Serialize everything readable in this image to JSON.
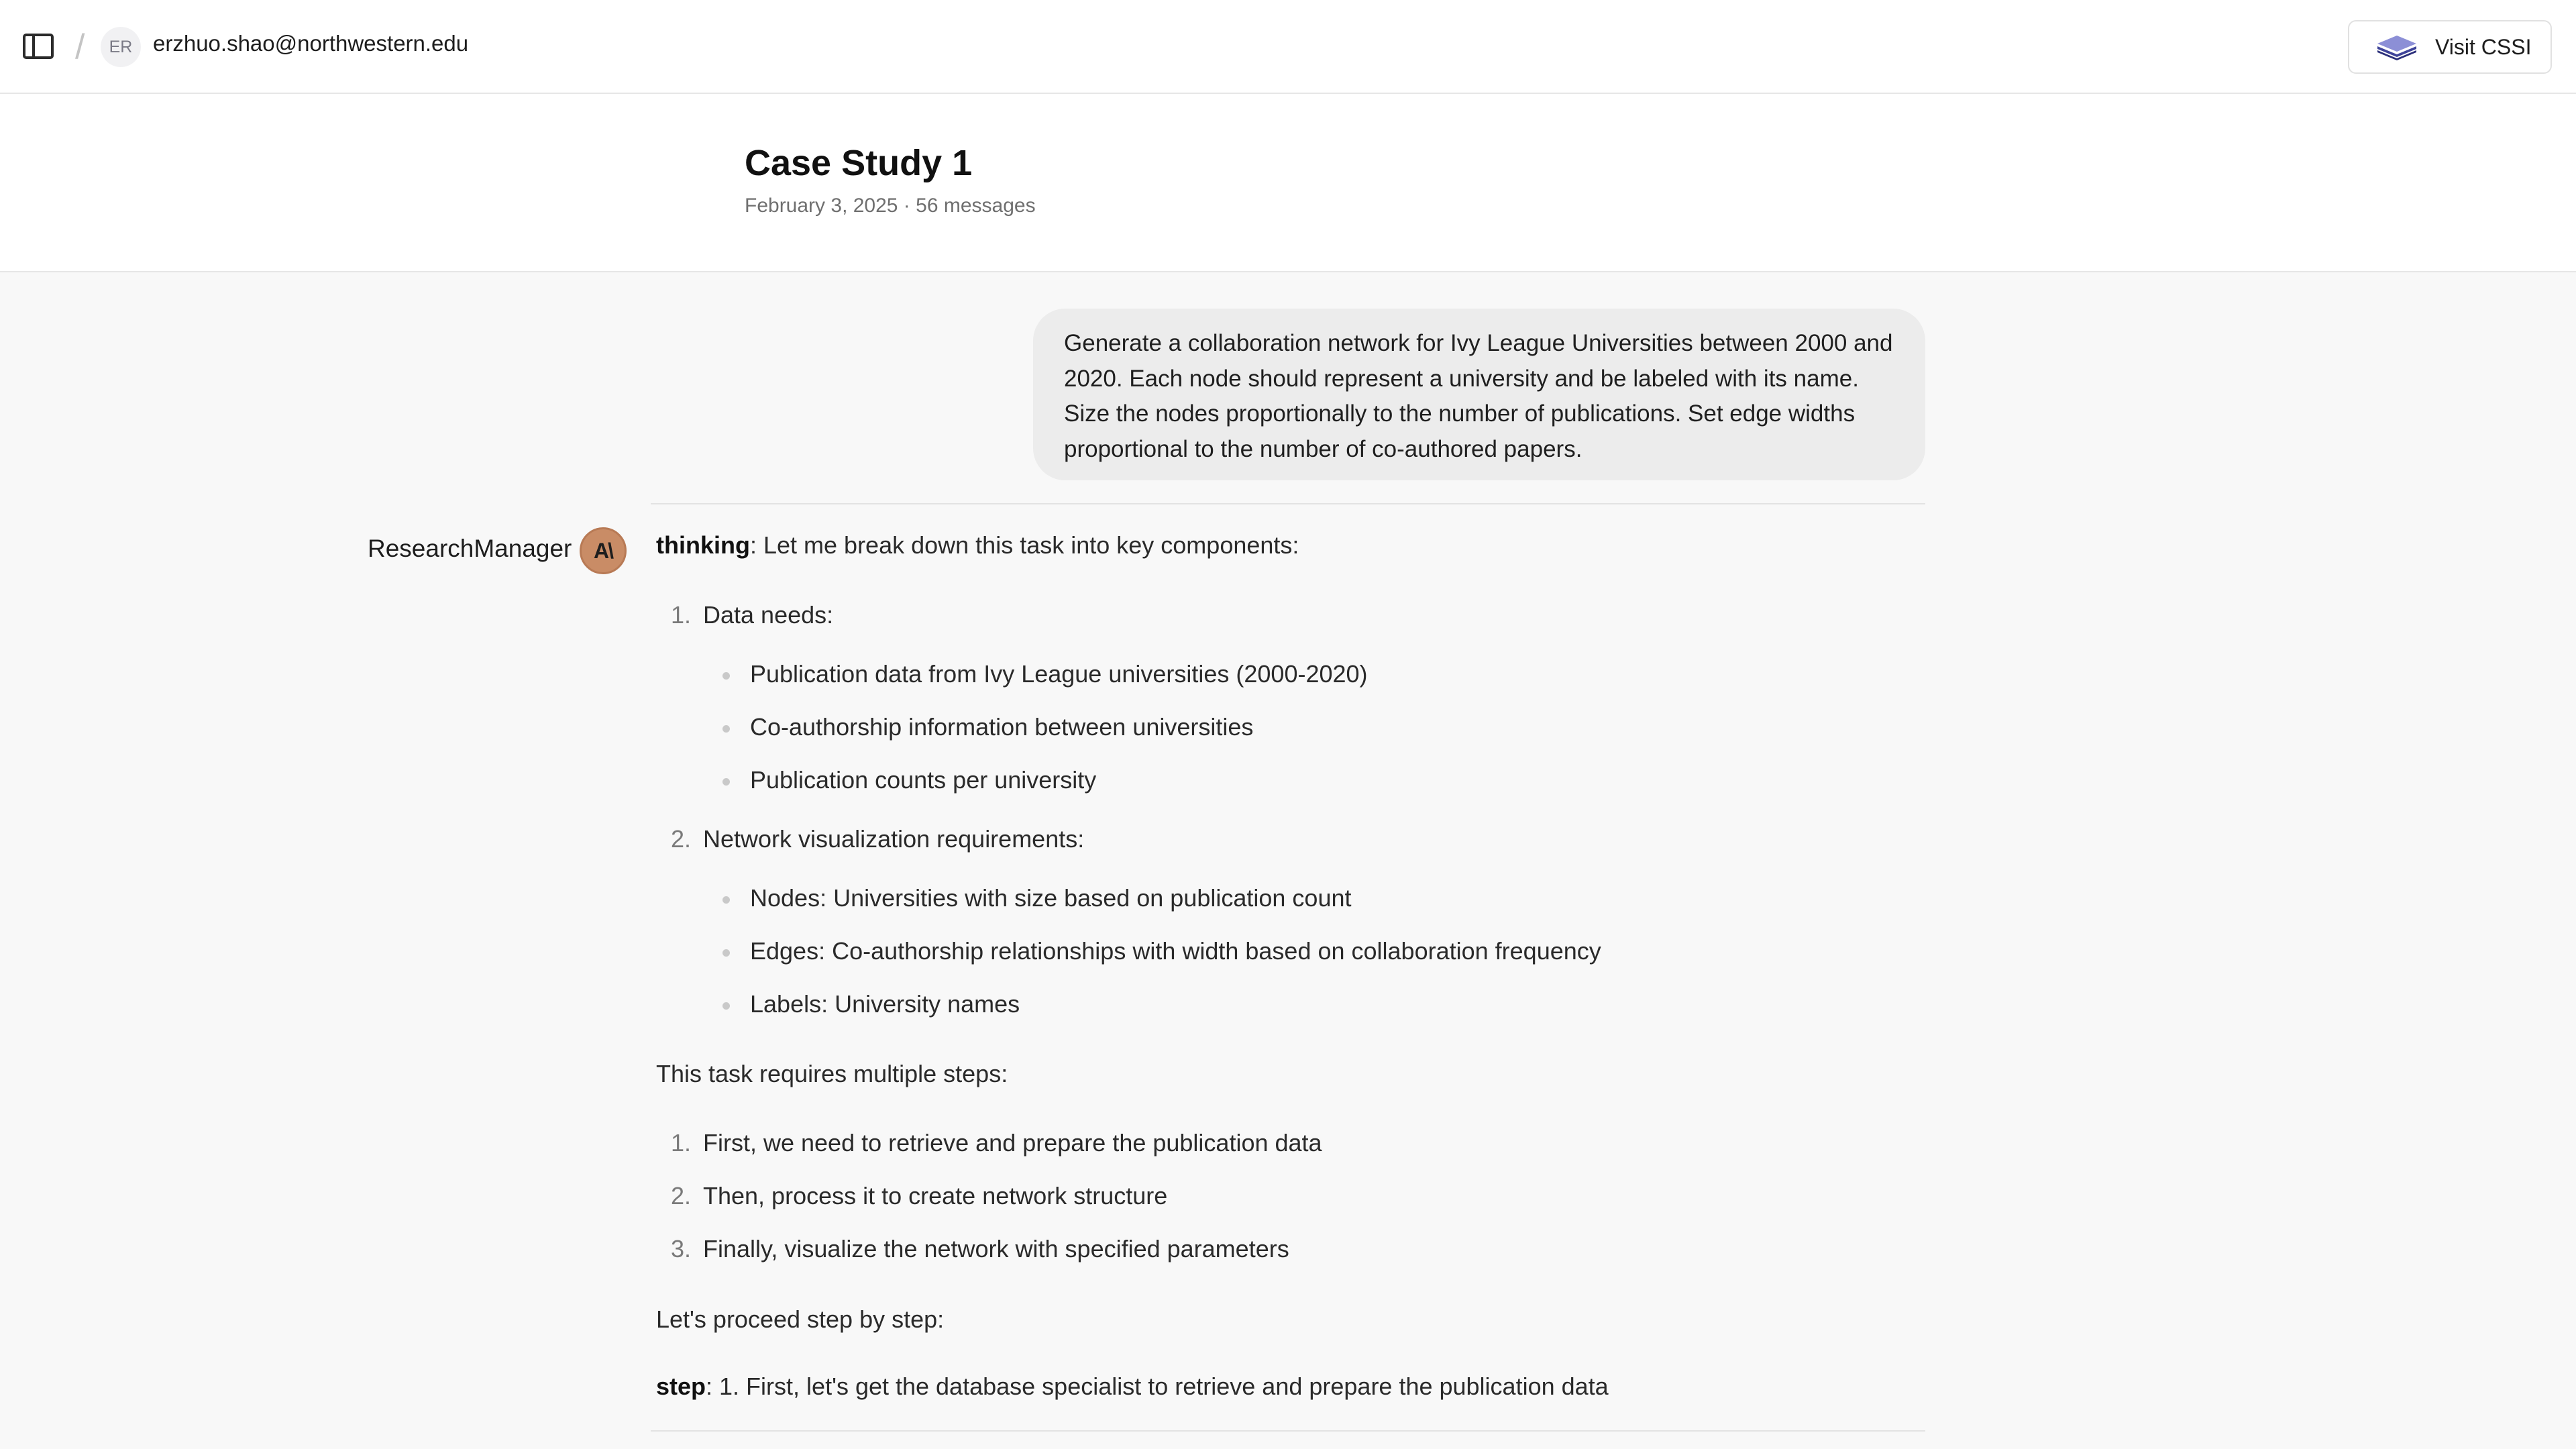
{
  "topbar": {
    "avatar_initials": "ER",
    "user_email": "erzhuo.shao@northwestern.edu",
    "visit_button_label": "Visit CSSI",
    "icons": [
      "sidebar-toggle-icon",
      "cssi-logo-icon"
    ]
  },
  "header": {
    "title": "Case Study 1",
    "meta": "February 3, 2025 · 56 messages"
  },
  "user_message": {
    "text": "Generate a collaboration network for Ivy League Universities between 2000 and 2020. Each node should represent a university and be labeled with its name. Size the nodes proportionally to the number of publications. Set edge widths proportional to the number of co-authored papers."
  },
  "agent": {
    "name": "ResearchManager",
    "avatar_text": "A\\",
    "thinking_label": "thinking",
    "thinking_intro": ": Let me break down this task into key components:",
    "list1": [
      {
        "num": "1.",
        "label": "Data needs:",
        "bullets": [
          "Publication data from Ivy League universities (2000-2020)",
          "Co-authorship information between universities",
          "Publication counts per university"
        ]
      },
      {
        "num": "2.",
        "label": "Network visualization requirements:",
        "bullets": [
          "Nodes: Universities with size based on publication count",
          "Edges: Co-authorship relationships with width based on collaboration frequency",
          "Labels: University names"
        ]
      }
    ],
    "steps_intro": "This task requires multiple steps:",
    "steps": [
      {
        "num": "1.",
        "text": "First, we need to retrieve and prepare the publication data"
      },
      {
        "num": "2.",
        "text": "Then, process it to create network structure"
      },
      {
        "num": "3.",
        "text": "Finally, visualize the network with specified parameters"
      }
    ],
    "proceed": "Let's proceed step by step:",
    "step_label": "step",
    "step_text": ": 1. First, let's get the database specialist to retrieve and prepare the publication data"
  }
}
